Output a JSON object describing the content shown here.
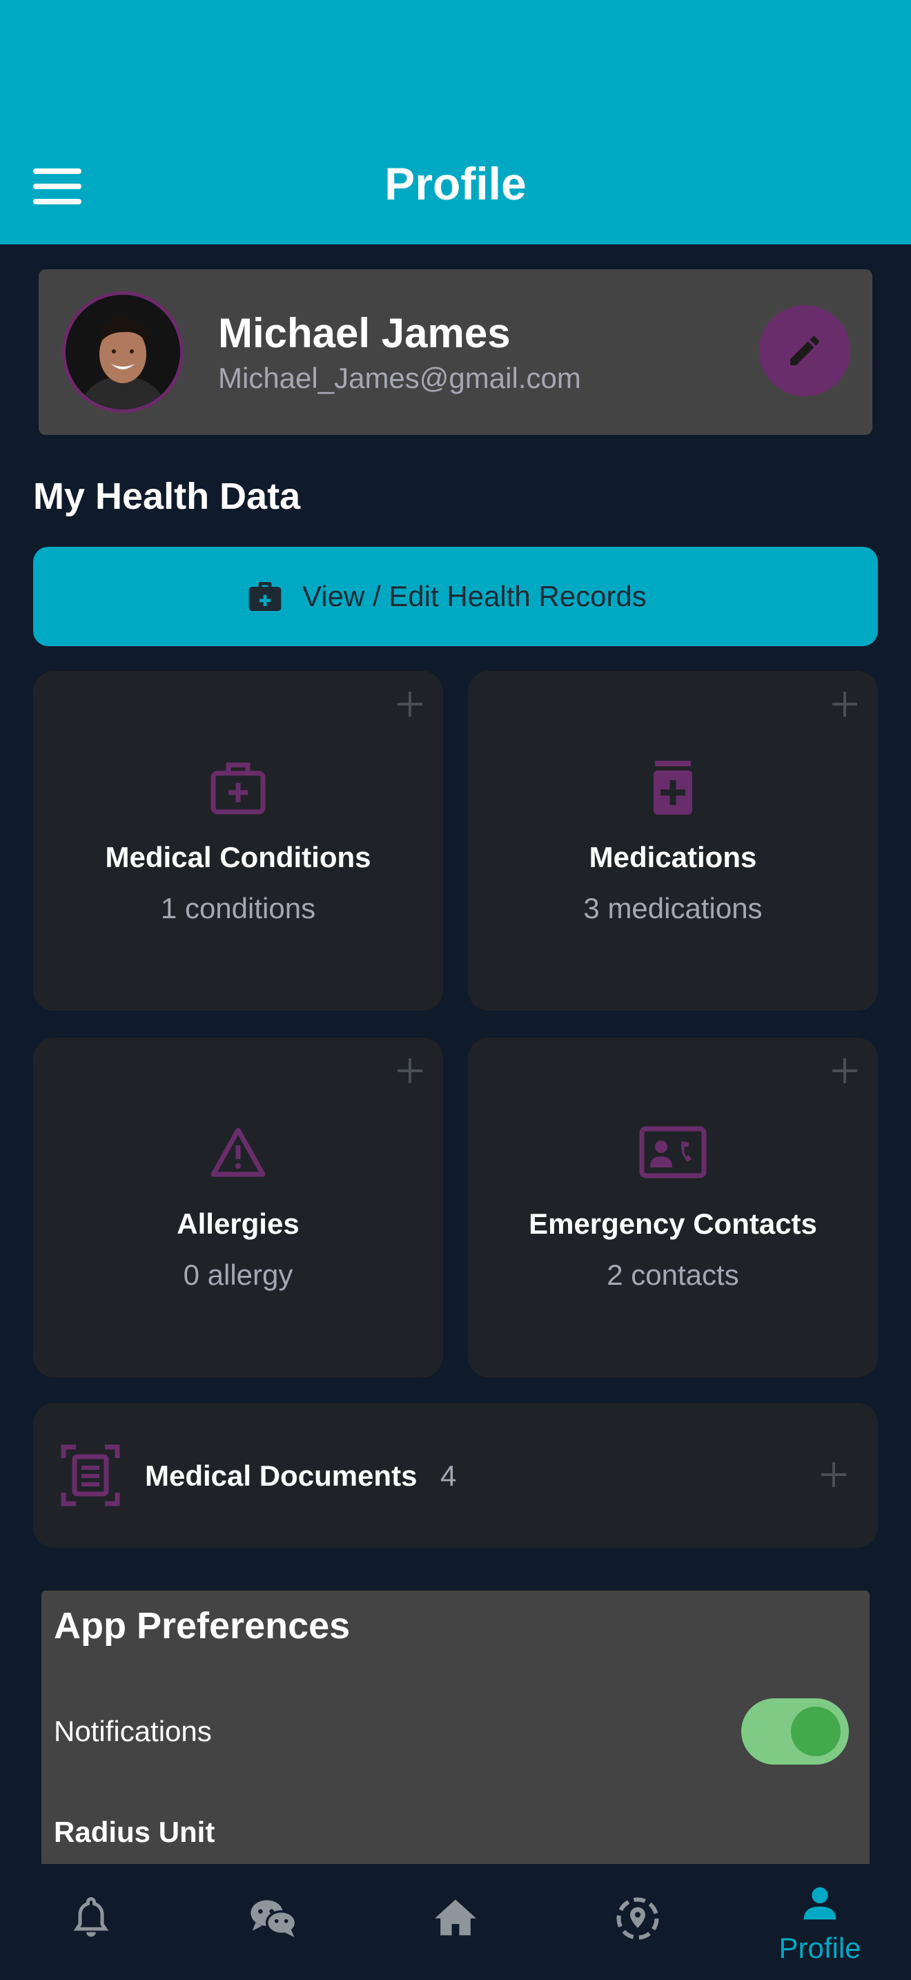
{
  "header": {
    "title": "Profile",
    "menu_icon": "hamburger-menu-icon",
    "background": "#00a9c3"
  },
  "profile": {
    "name": "Michael James",
    "email": "Michael_James@gmail.com",
    "edit_icon": "pencil-icon"
  },
  "health": {
    "section_title": "My Health Data",
    "records_button": {
      "label": "View / Edit Health Records",
      "icon": "medical-kit-icon"
    },
    "tiles": [
      {
        "title": "Medical Conditions",
        "subtitle": "1 conditions",
        "icon": "medical-bag-icon"
      },
      {
        "title": "Medications",
        "subtitle": "3 medications",
        "icon": "medicine-bottle-icon"
      },
      {
        "title": "Allergies",
        "subtitle": "0 allergy",
        "icon": "warning-triangle-icon"
      },
      {
        "title": "Emergency Contacts",
        "subtitle": "2 contacts",
        "icon": "contact-card-icon"
      }
    ],
    "documents": {
      "label": "Medical Documents",
      "count": "4",
      "icon": "document-scan-icon"
    }
  },
  "preferences": {
    "title": "App Preferences",
    "notifications_label": "Notifications",
    "notifications_on": true,
    "radius_label": "Radius Unit"
  },
  "bottom_nav": {
    "items": [
      {
        "icon": "bell-icon"
      },
      {
        "icon": "chat-icon"
      },
      {
        "icon": "home-icon"
      },
      {
        "icon": "location-icon"
      },
      {
        "icon": "person-icon",
        "label": "Profile",
        "active": true
      }
    ]
  },
  "colors": {
    "accent": "#00a9c3",
    "icon_purple": "#6a2d6b",
    "background": "#0f1a2a",
    "card": "#1f2327",
    "toggle_on": "#7fcb85"
  }
}
